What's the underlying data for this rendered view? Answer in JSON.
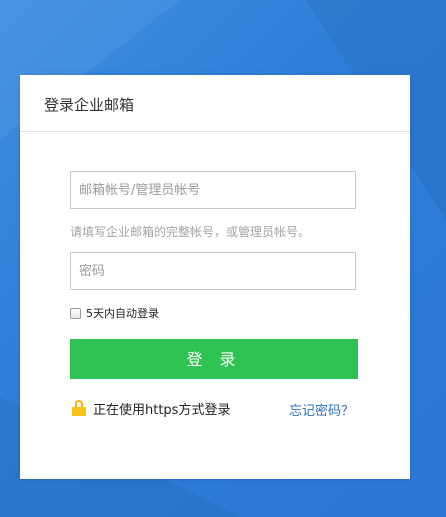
{
  "login": {
    "title": "登录企业邮箱",
    "account_placeholder": "邮箱帐号/管理员帐号",
    "hint": "请填写企业邮箱的完整帐号，或管理员帐号。",
    "password_placeholder": "密码",
    "remember_label": "5天内自动登录",
    "remember_checked": false,
    "submit_label": "登 录",
    "https_text": "正在使用https方式登录",
    "forgot_label": "忘记密码？"
  },
  "colors": {
    "background": "#2f80da",
    "submit_button": "#2ec352",
    "link": "#2a6fc0",
    "lock_icon": "#f8c21a"
  },
  "icons": {
    "lock": "lock-icon"
  }
}
